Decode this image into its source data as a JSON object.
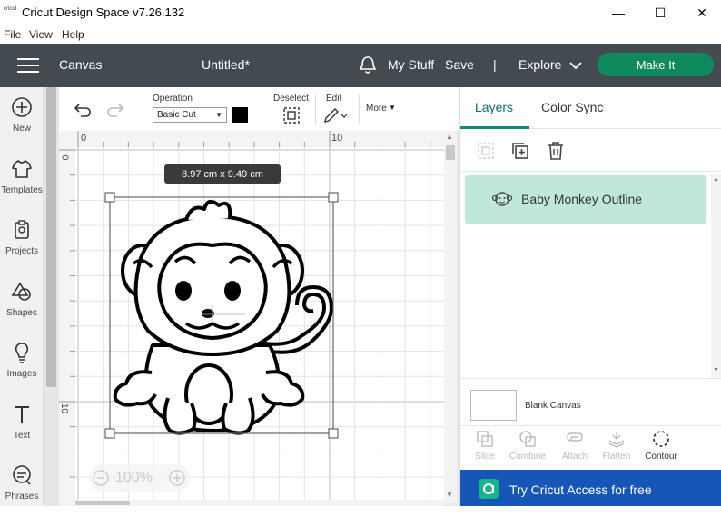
{
  "window": {
    "app_icon_text": "cricut",
    "title": "Cricut Design Space  v7.26.132",
    "minimize": "—",
    "maximize": "☐",
    "close": "✕"
  },
  "menu": [
    "File",
    "View",
    "Help"
  ],
  "header": {
    "canvas_label": "Canvas",
    "doc_title": "Untitled*",
    "my_stuff": "My Stuff",
    "save": "Save",
    "divider": "|",
    "explore": "Explore",
    "make_it": "Make It"
  },
  "sidebar": [
    {
      "label": "New",
      "icon": "plus-circle-icon"
    },
    {
      "label": "Templates",
      "icon": "shirt-icon"
    },
    {
      "label": "Projects",
      "icon": "projects-icon"
    },
    {
      "label": "Shapes",
      "icon": "shapes-icon"
    },
    {
      "label": "Images",
      "icon": "lightbulb-icon"
    },
    {
      "label": "Text",
      "icon": "text-icon"
    },
    {
      "label": "Phrases",
      "icon": "speech-bubble-icon"
    }
  ],
  "toolbar": {
    "operation_label": "Operation",
    "operation_value": "Basic Cut",
    "operation_color": "#000000",
    "deselect": "Deselect",
    "edit": "Edit",
    "more": "More"
  },
  "canvas": {
    "ruler_top": [
      "0",
      "10"
    ],
    "ruler_left": [
      "0",
      "10"
    ],
    "dimensions": "8.97  cm x 9.49  cm",
    "zoom": "100%"
  },
  "layers_panel": {
    "tabs": [
      "Layers",
      "Color Sync"
    ],
    "active_tab": "Layers",
    "layer_name": "Baby Monkey Outline",
    "blank_canvas": "Blank Canvas",
    "tools": [
      "Slice",
      "Combine",
      "Attach",
      "Flatten",
      "Contour"
    ],
    "access_text": "Try Cricut Access for free",
    "accent_color": "#0f8a5f",
    "access_color": "#1656b6"
  }
}
